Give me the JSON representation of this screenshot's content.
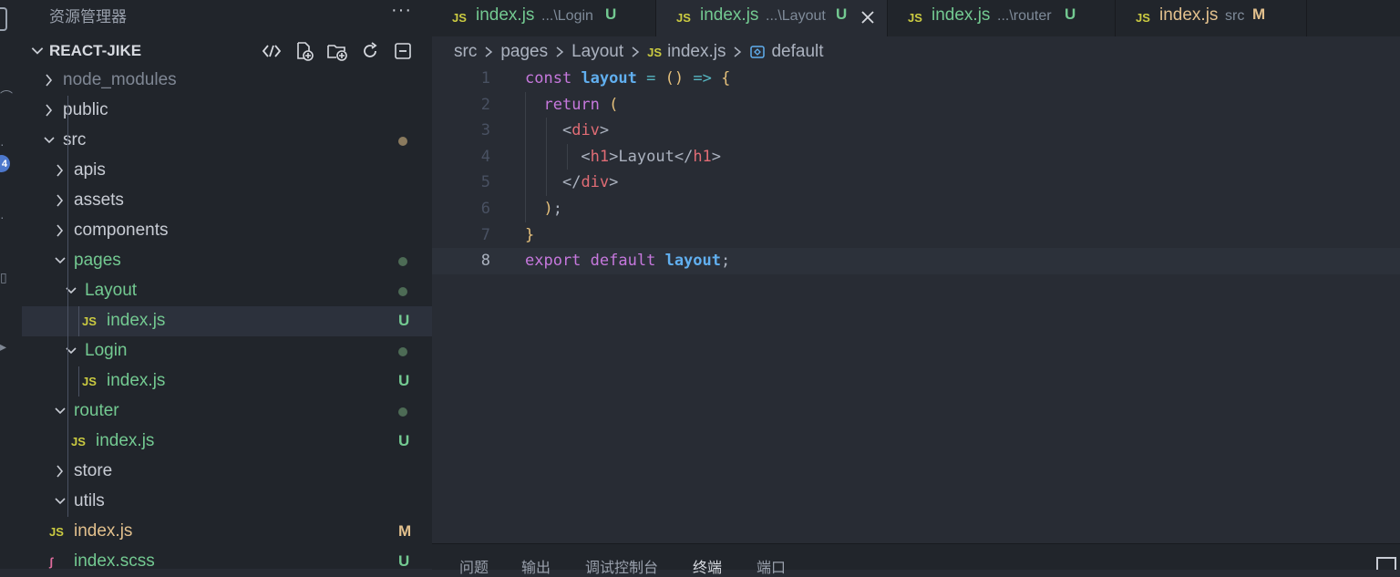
{
  "colors": {
    "added": "#73c991",
    "modified": "#e2c08d",
    "folder_dot": "#8a7a5e",
    "accent_badge": "#4d78cc"
  },
  "activity": {
    "badge_count": "4"
  },
  "sidebar": {
    "title": "资源管理器",
    "more_icon": "ellipsis-icon",
    "project": {
      "name": "REACT-JIKE",
      "tools": [
        "remote-explorer-icon",
        "new-file-icon",
        "new-folder-icon",
        "refresh-icon",
        "collapse-all-icon"
      ]
    },
    "tree": [
      {
        "label": "node_modules",
        "type": "folder",
        "open": false
      },
      {
        "label": "public",
        "type": "folder",
        "open": false
      },
      {
        "label": "src",
        "type": "folder",
        "open": true,
        "status": "dot"
      },
      {
        "label": "apis",
        "type": "folder",
        "open": false
      },
      {
        "label": "assets",
        "type": "folder",
        "open": false
      },
      {
        "label": "components",
        "type": "folder",
        "open": false
      },
      {
        "label": "pages",
        "type": "folder",
        "open": true,
        "status": "dot"
      },
      {
        "label": "Layout",
        "type": "folder",
        "open": true,
        "status": "dot"
      },
      {
        "label": "index.js",
        "type": "js",
        "status": "U",
        "selected": true
      },
      {
        "label": "Login",
        "type": "folder",
        "open": true,
        "status": "dot"
      },
      {
        "label": "index.js",
        "type": "js",
        "status": "U"
      },
      {
        "label": "router",
        "type": "folder",
        "open": true,
        "status": "dot"
      },
      {
        "label": "index.js",
        "type": "js",
        "status": "U"
      },
      {
        "label": "store",
        "type": "folder",
        "open": false
      },
      {
        "label": "utils",
        "type": "folder",
        "open": true
      },
      {
        "label": "index.js",
        "type": "js",
        "status": "M"
      },
      {
        "label": "index.scss",
        "type": "scss",
        "status": "U"
      }
    ]
  },
  "tabs": [
    {
      "icon": "JS",
      "name": "index.js",
      "path": "...\\Login",
      "status": "U"
    },
    {
      "icon": "JS",
      "name": "index.js",
      "path": "...\\Layout",
      "status": "U",
      "active": true
    },
    {
      "icon": "JS",
      "name": "index.js",
      "path": "...\\router",
      "status": "U"
    },
    {
      "icon": "JS",
      "name": "index.js",
      "path": "src",
      "status": "M"
    }
  ],
  "breadcrumb": {
    "seg1": "src",
    "seg2": "pages",
    "seg3": "Layout",
    "file_icon": "JS",
    "file": "index.js",
    "symbol": "default"
  },
  "code": {
    "current_line": 8,
    "lines": [
      "const layout = () => {",
      "  return (",
      "    <div>",
      "      <h1>Layout</h1>",
      "    </div>",
      "  );",
      "}",
      "export default layout;"
    ]
  },
  "panel": {
    "tabs": [
      "问题",
      "输出",
      "调试控制台",
      "终端",
      "端口"
    ],
    "active": "终端"
  }
}
